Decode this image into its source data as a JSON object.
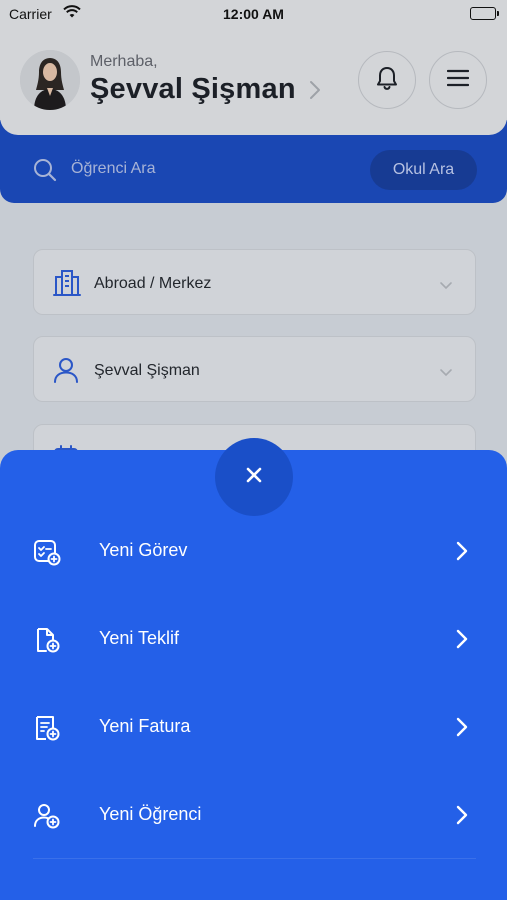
{
  "status_bar": {
    "carrier": "Carrier",
    "time": "12:00 AM"
  },
  "header": {
    "greeting": "Merhaba,",
    "user_name": "Şevval Şişman",
    "icons": {
      "notifications": "bell-icon",
      "menu": "hamburger-icon",
      "profile": "chevron-right-icon"
    }
  },
  "search": {
    "placeholder": "Öğrenci Ara",
    "school_button": "Okul Ara",
    "icon": "search-icon"
  },
  "filters": [
    {
      "label": "Abroad / Merkez",
      "icon": "building-icon"
    },
    {
      "label": "Şevval Şişman",
      "icon": "user-icon"
    },
    {
      "label": "",
      "icon": "calendar-icon"
    }
  ],
  "action_sheet": {
    "close_icon": "close-icon",
    "items": [
      {
        "label": "Yeni Görev",
        "icon": "task-add-icon"
      },
      {
        "label": "Yeni Teklif",
        "icon": "document-add-icon"
      },
      {
        "label": "Yeni Fatura",
        "icon": "invoice-add-icon"
      },
      {
        "label": "Yeni Öğrenci",
        "icon": "user-add-icon"
      }
    ]
  },
  "colors": {
    "brand_blue": "#2460e8",
    "search_band": "#1a47b3",
    "overlay_bg": "#c7ccd3"
  }
}
